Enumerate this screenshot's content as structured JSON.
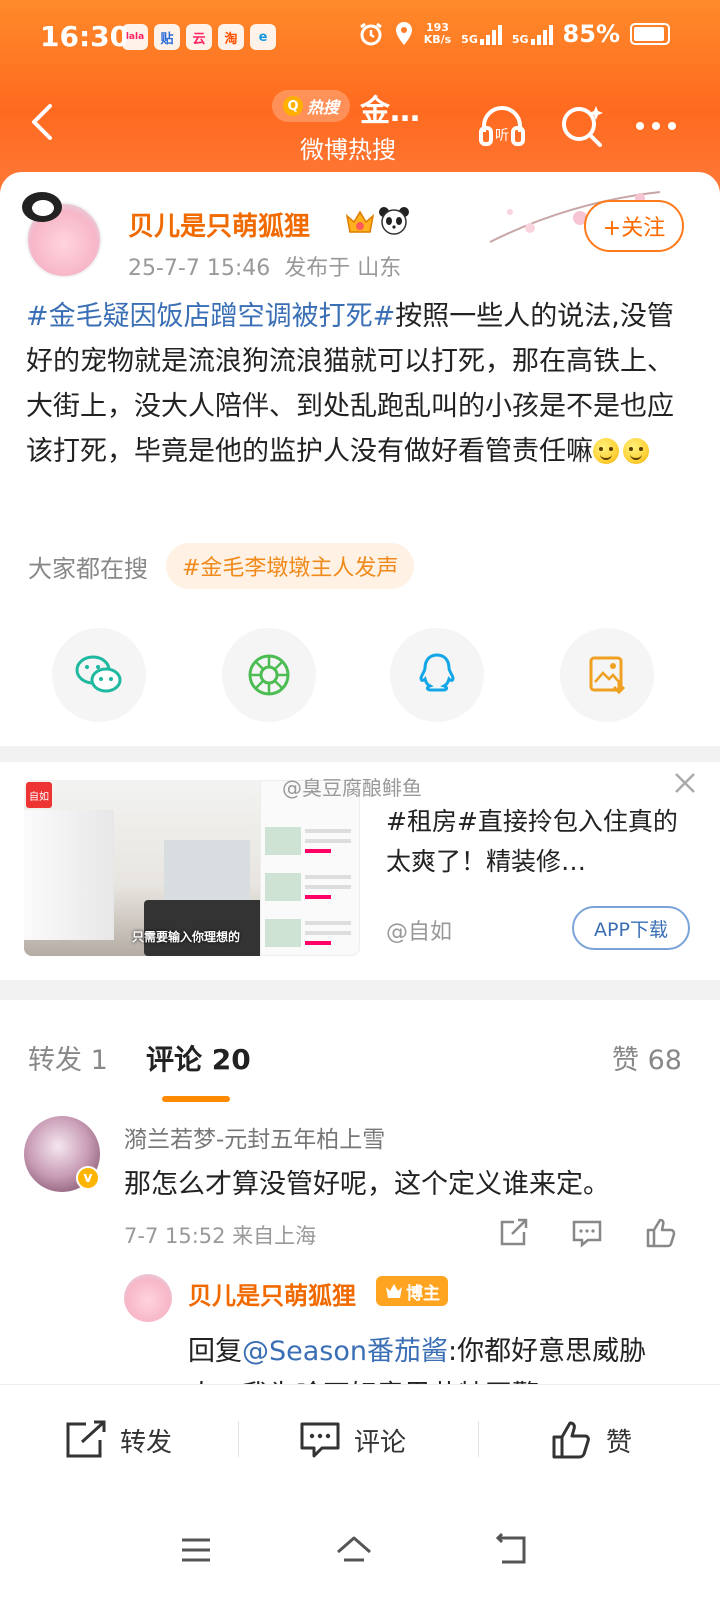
{
  "status_bar": {
    "time": "16:30",
    "app_icons": [
      "lala",
      "贴",
      "云",
      "淘",
      "e"
    ],
    "net_speed_value": "193",
    "net_speed_unit": "KB/s",
    "signal_1": "5G",
    "signal_2": "5G",
    "battery": "85%"
  },
  "nav": {
    "hot_search_chip": "热搜",
    "title": "金…",
    "subtitle": "微博热搜",
    "icons": [
      "back-icon",
      "listen-icon",
      "search-sparkle-icon",
      "more-icon"
    ]
  },
  "post": {
    "author": "贝儿是只萌狐狸",
    "timestamp": "25-7-7 15:46",
    "location": "发布于 山东",
    "follow_label": "+关注",
    "hashtag": "#金毛疑因饭店蹭空调被打死#",
    "body": "按照一些人的说法,没管好的宠物就是流浪狗流浪猫就可以打死，那在高铁上、大街上，没大人陪伴、到处乱跑乱叫的小孩是不是也应该打死，毕竟是他的监护人没有做好看管责任嘛",
    "emoji_count": 2
  },
  "everyone_searching": {
    "label": "大家都在搜",
    "chip": "#金毛李墩墩主人发声"
  },
  "share": [
    "wechat-icon",
    "moments-icon",
    "qq-icon",
    "save-image-icon"
  ],
  "ad": {
    "watermark": "@臭豆腐酿鲱鱼",
    "image_caption": "只需要输入你理想的",
    "logo_text": "自如",
    "text": "#租房#直接拎包入住真的太爽了！精装修…",
    "source": "@自如",
    "button": "APP下载"
  },
  "tabs": {
    "repost": "转发 1",
    "comments": "评论 20",
    "likes": "赞 68"
  },
  "comment": {
    "name": "漪兰若梦-元封五年柏上雪",
    "text": "那怎么才算没管好呢，这个定义谁来定。",
    "meta": "7-7 15:52  来自上海",
    "verify": "v"
  },
  "reply": {
    "name": "贝儿是只萌狐狸",
    "badge": "博主",
    "prefix": "回复",
    "mention": "@Season番茄酱",
    "text": ":你都好意思威胁人，我为啥不好意思艾特网警?"
  },
  "actionbar": {
    "repost": "转发",
    "comment": "评论",
    "like": "赞"
  },
  "colors": {
    "header_orange": "#ff6a1f",
    "author_orange": "#f06a00",
    "link_blue": "#3b6fb5",
    "tab_underline": "#ff8a00"
  }
}
